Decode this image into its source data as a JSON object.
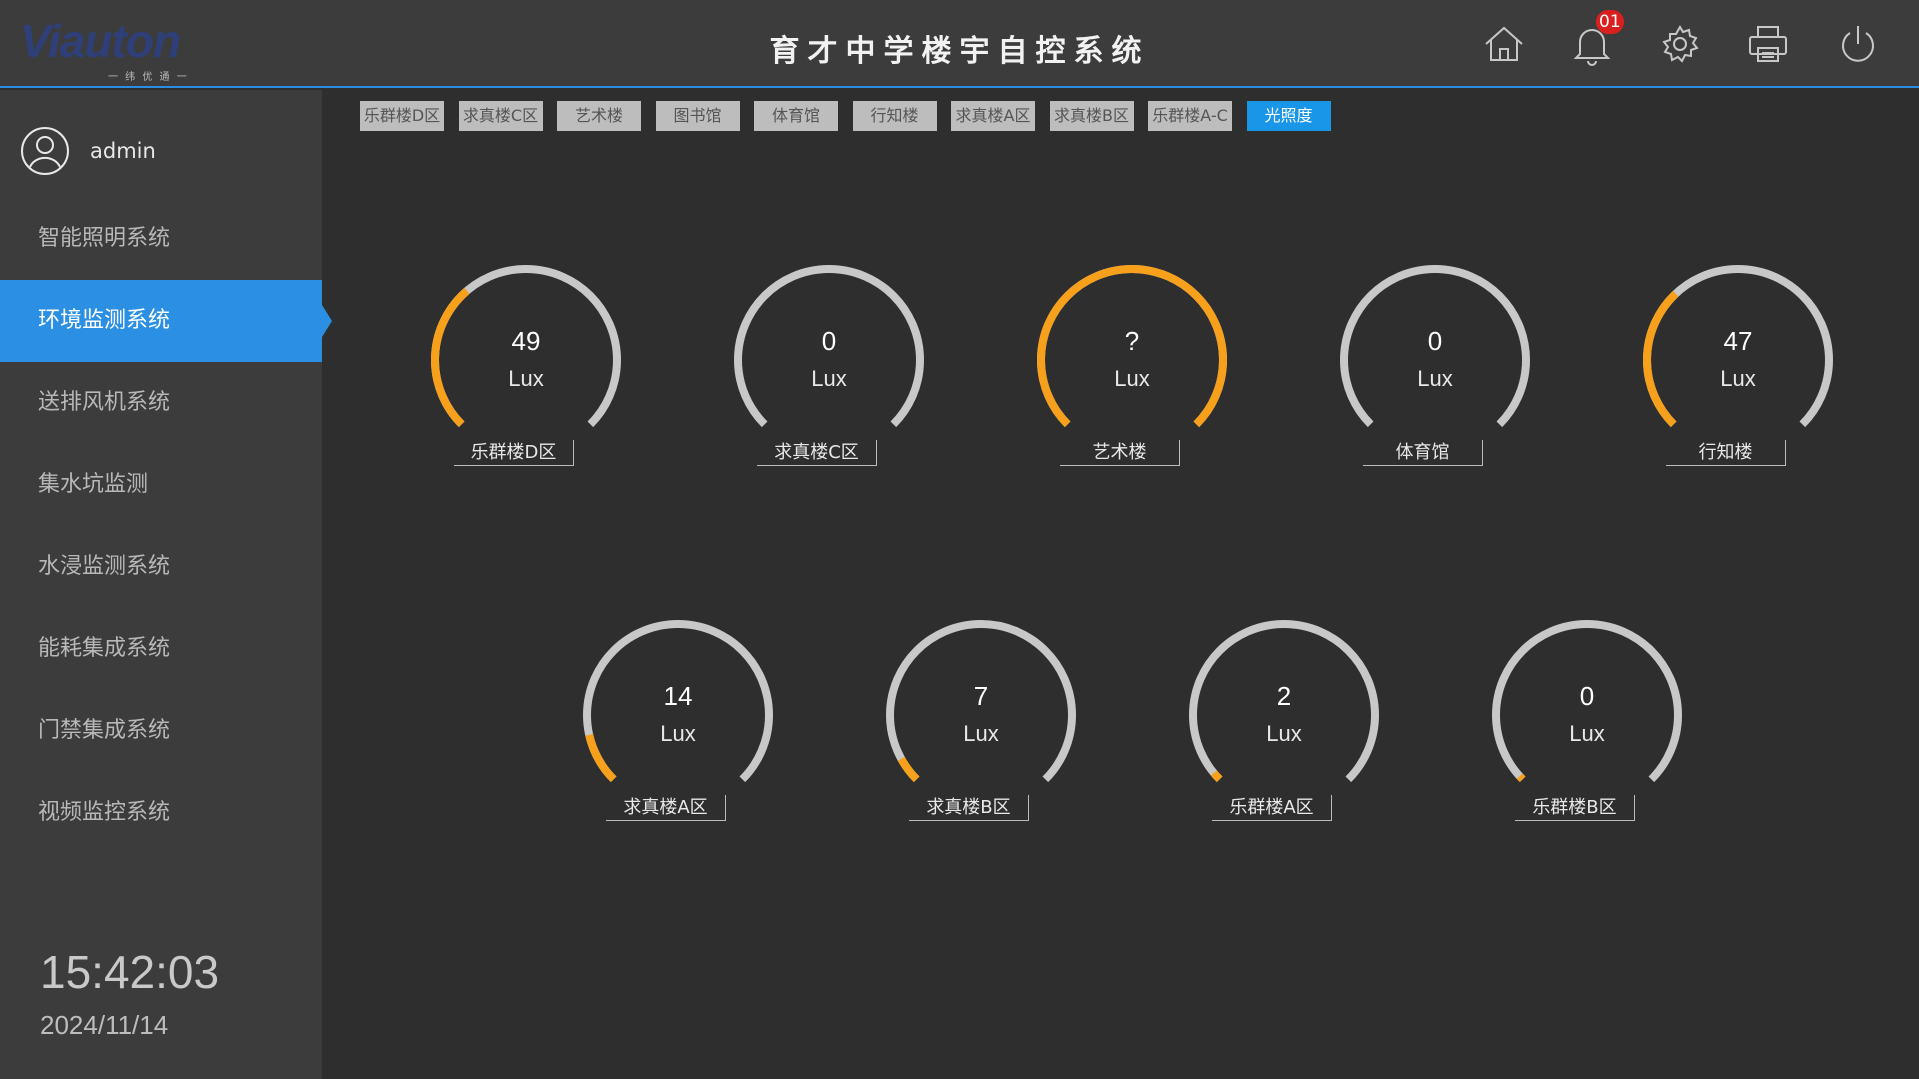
{
  "header": {
    "logo_text": "Viauton",
    "logo_sub": "一 纬 优 通 一",
    "title": "育才中学楼宇自控系统",
    "notification_count": "01",
    "icons": [
      "home-icon",
      "bell-icon",
      "gear-icon",
      "printer-icon",
      "power-icon"
    ]
  },
  "sidebar": {
    "username": "admin",
    "items": [
      {
        "label": "智能照明系统"
      },
      {
        "label": "环境监测系统"
      },
      {
        "label": "送排风机系统"
      },
      {
        "label": "集水坑监测"
      },
      {
        "label": "水浸监测系统"
      },
      {
        "label": "能耗集成系统"
      },
      {
        "label": "门禁集成系统"
      },
      {
        "label": "视频监控系统"
      }
    ],
    "active_index": 1,
    "time": "15:42:03",
    "date": "2024/11/14"
  },
  "tabs": {
    "items": [
      {
        "label": "乐群楼D区"
      },
      {
        "label": "求真楼C区"
      },
      {
        "label": "艺术楼"
      },
      {
        "label": "图书馆"
      },
      {
        "label": "体育馆"
      },
      {
        "label": "行知楼"
      },
      {
        "label": "求真楼A区"
      },
      {
        "label": "求真楼B区"
      },
      {
        "label": "乐群楼A-C"
      },
      {
        "label": "光照度"
      }
    ],
    "active_index": 9
  },
  "gauges": {
    "unit": "Lux",
    "accent_color": "#f7a01c",
    "track_color": "#c8c8c8",
    "items": [
      {
        "label": "乐群楼D区",
        "value": "49",
        "fill": 0.35
      },
      {
        "label": "求真楼C区",
        "value": "0",
        "fill": 0
      },
      {
        "label": "艺术楼",
        "value": "?",
        "fill": 1.0
      },
      {
        "label": "体育馆",
        "value": "0",
        "fill": 0
      },
      {
        "label": "行知楼",
        "value": "47",
        "fill": 0.34
      },
      {
        "label": "求真楼A区",
        "value": "14",
        "fill": 0.12
      },
      {
        "label": "求真楼B区",
        "value": "7",
        "fill": 0.06
      },
      {
        "label": "乐群楼A区",
        "value": "2",
        "fill": 0.02
      },
      {
        "label": "乐群楼B区",
        "value": "0",
        "fill": 0.01
      }
    ]
  }
}
